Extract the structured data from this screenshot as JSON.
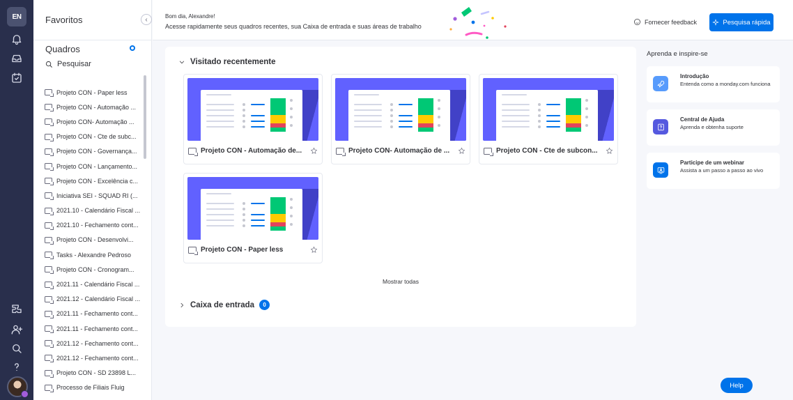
{
  "rail": {
    "logo": "EN",
    "icons": [
      "bell-icon",
      "inbox-icon",
      "my-work-icon",
      "apps-icon",
      "invite-icon",
      "search-icon",
      "help-icon"
    ]
  },
  "sidebar": {
    "favorites_label": "Favoritos",
    "collapse_glyph": "‹",
    "boards_label": "Quadros",
    "search_label": "Pesquisar",
    "boards": [
      "Projeto CON - Paper less",
      "Projeto CON - Automação ...",
      "Projeto CON- Automação ...",
      "Projeto CON - Cte de subc...",
      "Projeto CON - Governança...",
      "Projeto CON - Lançamento...",
      "Projeto CON - Excelência c...",
      "Iniciativa SEI - SQUAD RI (...",
      "2021.10 - Calendário Fiscal ...",
      "2021.10 - Fechamento cont...",
      "Projeto CON - Desenvolvi...",
      "Tasks - Alexandre Pedroso",
      "Projeto CON - Cronogram...",
      "2021.11 - Calendário Fiscal ...",
      "2021.12 - Calendário Fiscal ...",
      "2021.11 - Fechamento cont...",
      "2021.11 - Fechamento cont...",
      "2021.12 - Fechamento cont...",
      "2021.12 - Fechamento cont...",
      "Projeto CON - SD 23898 L...",
      "Processo de Filiais Fluig"
    ]
  },
  "topbar": {
    "greeting": "Bom dia, Alexandre!",
    "subtitle": "Acesse rapidamente seus quadros recentes, sua Caixa de entrada e suas áreas de trabalho",
    "feedback_label": "Fornecer feedback",
    "quick_search_label": "Pesquisa rápida"
  },
  "main": {
    "recent_title": "Visitado recentemente",
    "recent_boards": [
      "Projeto CON - Automação de...",
      "Projeto CON- Automação de ...",
      "Projeto CON - Cte de subcon...",
      "Projeto CON - Paper less"
    ],
    "show_all_label": "Mostrar todas",
    "inbox_title": "Caixa de entrada",
    "inbox_count": "0"
  },
  "learn": {
    "title": "Aprenda e inspire-se",
    "cards": [
      {
        "title": "Introdução",
        "subtitle": "Entenda como a monday.com funciona",
        "icon": "rocket-icon",
        "color": "#579bfc"
      },
      {
        "title": "Central de Ajuda",
        "subtitle": "Aprenda e obtenha suporte",
        "icon": "help-center-icon",
        "color": "#5559df"
      },
      {
        "title": "Participe de um webinar",
        "subtitle": "Assista a um passo a passo ao vivo",
        "icon": "webinar-icon",
        "color": "#0073ea"
      }
    ]
  },
  "help_label": "Help",
  "colors": {
    "accent": "#0073ea",
    "rail": "#292f4c",
    "thumb": "#6161ff"
  }
}
